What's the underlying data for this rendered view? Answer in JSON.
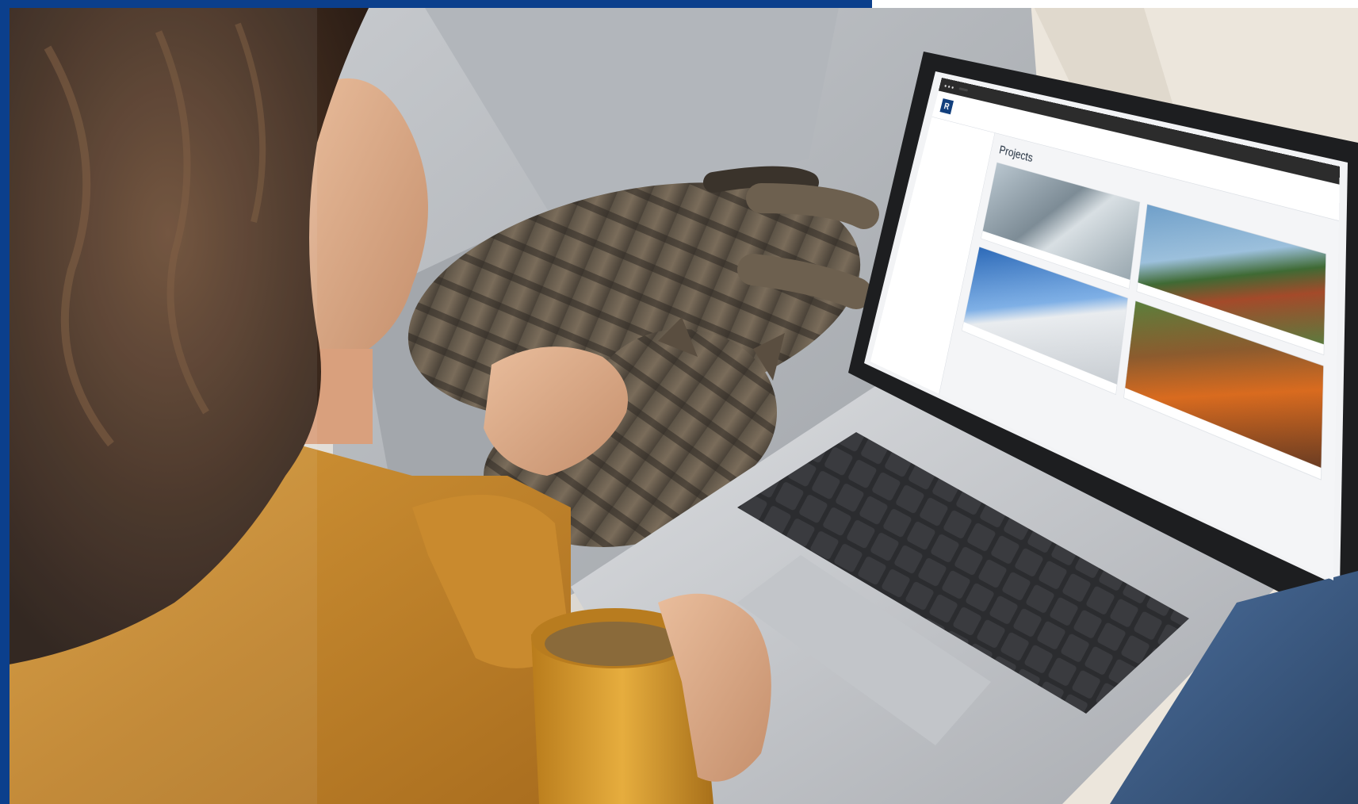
{
  "scene": {
    "subject": "woman-with-laptop-cat-and-mug"
  },
  "colors": {
    "accent": "#0b3f8c",
    "wall": "#e7e4df",
    "sofa": "#b9bcc0",
    "sweater": "#c4892c",
    "mug": "#d49a2a",
    "laptop": "#c9cbcf"
  },
  "screen": {
    "brand": "",
    "page_title": "Projects",
    "nav_items": [
      "",
      "",
      "",
      "",
      ""
    ],
    "sidebar_sections": [
      "",
      "",
      ""
    ],
    "cards": [
      "",
      "",
      "",
      ""
    ]
  }
}
